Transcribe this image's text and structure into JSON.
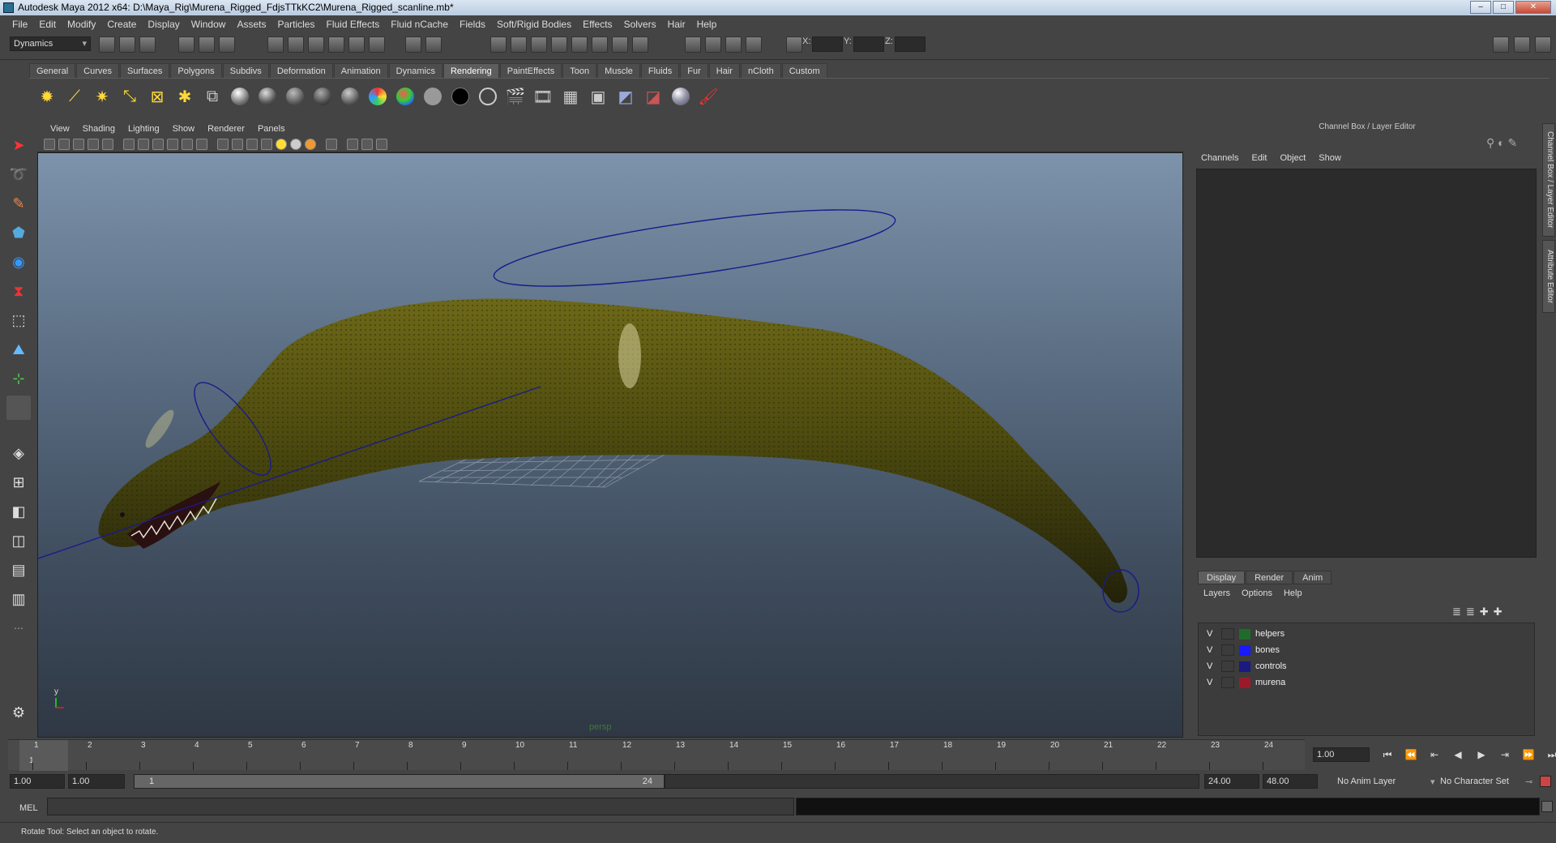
{
  "window": {
    "title": "Autodesk Maya 2012 x64: D:\\Maya_Rig\\Murena_Rigged_FdjsTTkKC2\\Murena_Rigged_scanline.mb*"
  },
  "menubar": [
    "File",
    "Edit",
    "Modify",
    "Create",
    "Display",
    "Window",
    "Assets",
    "Particles",
    "Fluid Effects",
    "Fluid nCache",
    "Fields",
    "Soft/Rigid Bodies",
    "Effects",
    "Solvers",
    "Hair",
    "Help"
  ],
  "statusline": {
    "mode": "Dynamics",
    "x_label": "X:",
    "y_label": "Y:",
    "z_label": "Z:"
  },
  "shelf_tabs": [
    "General",
    "Curves",
    "Surfaces",
    "Polygons",
    "Subdivs",
    "Deformation",
    "Animation",
    "Dynamics",
    "Rendering",
    "PaintEffects",
    "Toon",
    "Muscle",
    "Fluids",
    "Fur",
    "Hair",
    "nCloth",
    "Custom"
  ],
  "shelf_active": "Rendering",
  "viewport": {
    "menu": [
      "View",
      "Shading",
      "Lighting",
      "Show",
      "Renderer",
      "Panels"
    ],
    "camera_label": "persp",
    "axis_label": "y"
  },
  "channel_box": {
    "title": "Channel Box / Layer Editor",
    "menu": [
      "Channels",
      "Edit",
      "Object",
      "Show"
    ]
  },
  "side_tabs": [
    "Channel Box / Layer Editor",
    "Attribute Editor"
  ],
  "layer_editor": {
    "tabs": [
      "Display",
      "Render",
      "Anim"
    ],
    "active_tab": "Display",
    "menu": [
      "Layers",
      "Options",
      "Help"
    ],
    "layers": [
      {
        "visible": "V",
        "name": "helpers",
        "color": "#1e6b2a"
      },
      {
        "visible": "V",
        "name": "bones",
        "color": "#1a1aff"
      },
      {
        "visible": "V",
        "name": "controls",
        "color": "#1a1a80"
      },
      {
        "visible": "V",
        "name": "murena",
        "color": "#9b1a2a"
      }
    ]
  },
  "timeline": {
    "ticks": [
      "1",
      "2",
      "3",
      "4",
      "5",
      "6",
      "7",
      "8",
      "9",
      "10",
      "11",
      "12",
      "13",
      "14",
      "15",
      "16",
      "17",
      "18",
      "19",
      "20",
      "21",
      "22",
      "23",
      "24"
    ],
    "current_frame_marker": "1",
    "current_time": "1.00"
  },
  "range": {
    "start_time": "1.00",
    "playback_start": "1.00",
    "range_left": "1",
    "range_right": "24",
    "playback_end": "24.00",
    "end_time": "48.00",
    "anim_layer": "No Anim Layer",
    "character_set": "No Character Set"
  },
  "command_line": {
    "label": "MEL"
  },
  "help_line": {
    "text": "Rotate Tool: Select an object to rotate."
  }
}
